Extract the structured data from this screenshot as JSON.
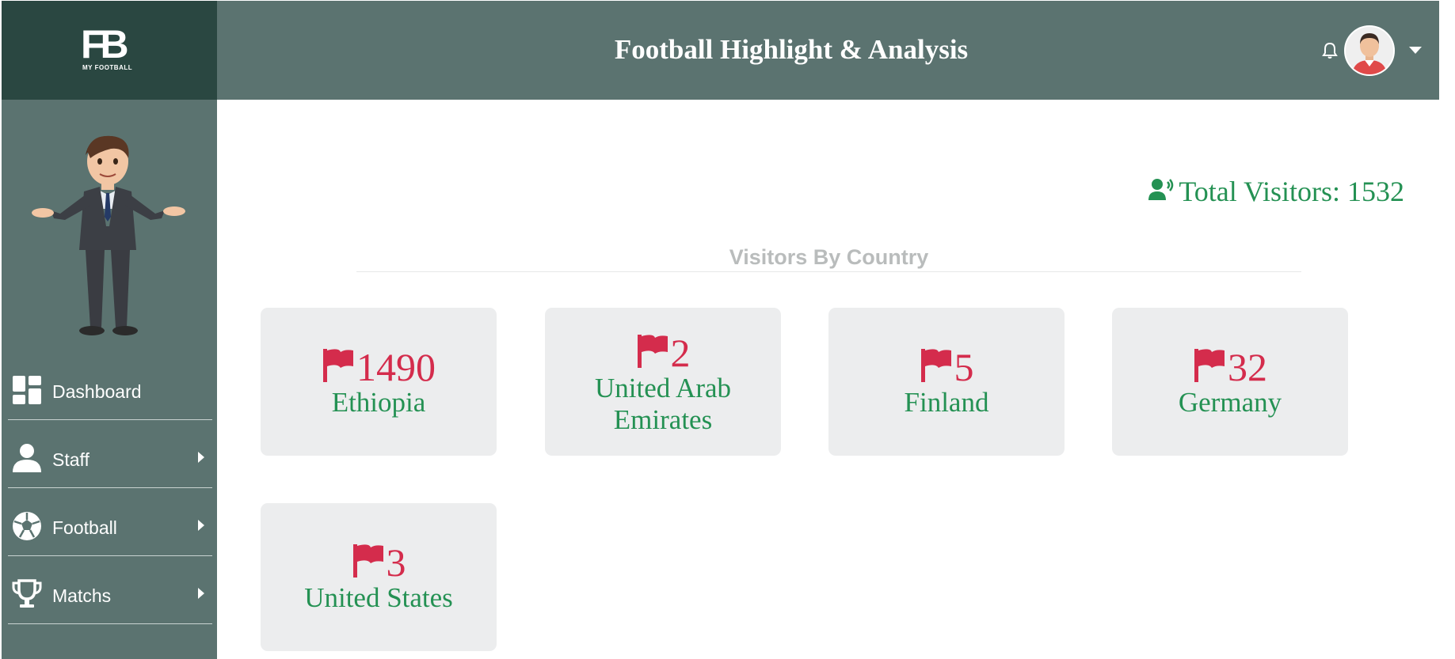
{
  "brand": {
    "logo_text": "FB",
    "logo_subtext": "MY FOOTBALL"
  },
  "header": {
    "title": "Football Highlight & Analysis",
    "notification_icon": "bell-icon",
    "profile_icon": "user-avatar"
  },
  "sidebar": {
    "items": [
      {
        "label": "Dashboard",
        "icon": "dashboard-grid-icon",
        "has_submenu": false
      },
      {
        "label": "Staff",
        "icon": "person-icon",
        "has_submenu": true
      },
      {
        "label": "Football",
        "icon": "soccer-ball-icon",
        "has_submenu": true
      },
      {
        "label": "Matchs",
        "icon": "trophy-icon",
        "has_submenu": true
      }
    ]
  },
  "main": {
    "total_visitors_label": "Total Visitors: 1532",
    "section_title": "Visitors By Country",
    "countries": [
      {
        "count": "1490",
        "name": "Ethiopia"
      },
      {
        "count": "2",
        "name": "United Arab Emirates"
      },
      {
        "count": "5",
        "name": "Finland"
      },
      {
        "count": "32",
        "name": "Germany"
      },
      {
        "count": "3",
        "name": "United States"
      }
    ]
  },
  "colors": {
    "sidebar": "#5b7370",
    "logo_bg": "#2a4741",
    "accent_green": "#249153",
    "accent_red": "#d42c4c",
    "card_bg": "#ecedee"
  }
}
